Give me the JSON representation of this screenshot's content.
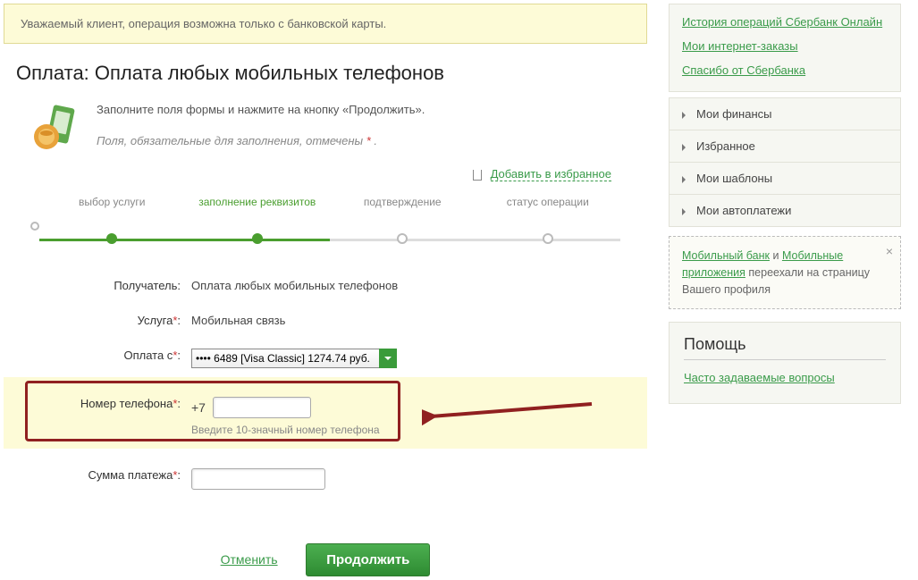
{
  "alert": "Уважаемый клиент, операция возможна только с банковской карты.",
  "page_title": "Оплата: Оплата любых мобильных телефонов",
  "intro": {
    "line1": "Заполните поля формы и нажмите на кнопку «Продолжить».",
    "line2_a": "Поля, обязательные для заполнения, отмечены ",
    "line2_b": " ."
  },
  "fav_link": "Добавить в избранное",
  "steps": [
    "выбор услуги",
    "заполнение реквизитов",
    "подтверждение",
    "статус операции"
  ],
  "form": {
    "recipient_label": "Получатель:",
    "recipient_value": "Оплата любых мобильных телефонов",
    "service_label": "Услуга",
    "service_value": "Мобильная связь",
    "card_label": "Оплата с",
    "card_value": "•••• 6489 [Visa Classic] 1274.74 руб.",
    "phone_label": "Номер телефона",
    "phone_prefix": "+7",
    "phone_hint": "Введите 10-значный номер телефона",
    "amount_label": "Сумма платежа"
  },
  "actions": {
    "cancel": "Отменить",
    "continue": "Продолжить"
  },
  "sidebar": {
    "links": [
      "История операций Сбербанк Онлайн",
      "Мои интернет-заказы",
      "Спасибо от Сбербанка"
    ],
    "panels": [
      "Мои финансы",
      "Избранное",
      "Мои шаблоны",
      "Мои автоплатежи"
    ],
    "note_a": "Мобильный банк",
    "note_b": " и ",
    "note_c": "Мобильные приложения",
    "note_d": " переехали на страницу Вашего профиля",
    "help_title": "Помощь",
    "help_link": "Часто задаваемые вопросы"
  }
}
